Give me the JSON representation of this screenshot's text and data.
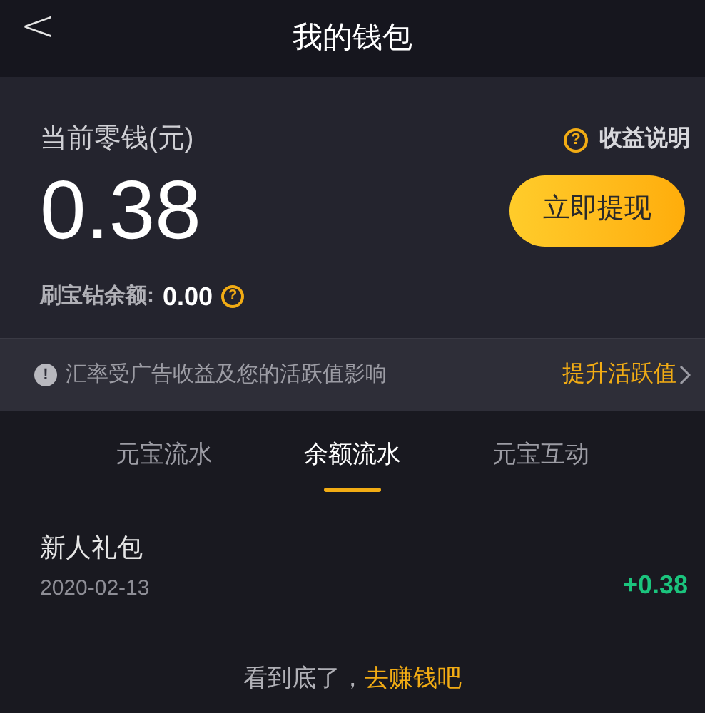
{
  "header": {
    "back": "<",
    "title": "我的钱包"
  },
  "balance": {
    "label": "当前零钱(元)",
    "help_icon": "?",
    "help_link": "收益说明",
    "amount": "0.38",
    "withdraw_button": "立即提现",
    "diamond_label": "刷宝钻余额:",
    "diamond_amount": "0.00",
    "diamond_help_icon": "?"
  },
  "notice": {
    "icon": "!",
    "text": "汇率受广告收益及您的活跃值影响",
    "link": "提升活跃值"
  },
  "tabs": [
    {
      "label": "元宝流水",
      "selected": false
    },
    {
      "label": "余额流水",
      "selected": true
    },
    {
      "label": "元宝互动",
      "selected": false
    }
  ],
  "transactions": [
    {
      "title": "新人礼包",
      "date": "2020-02-13",
      "amount": "+0.38"
    }
  ],
  "footer": {
    "text": "看到底了，",
    "link": "去赚钱吧"
  }
}
